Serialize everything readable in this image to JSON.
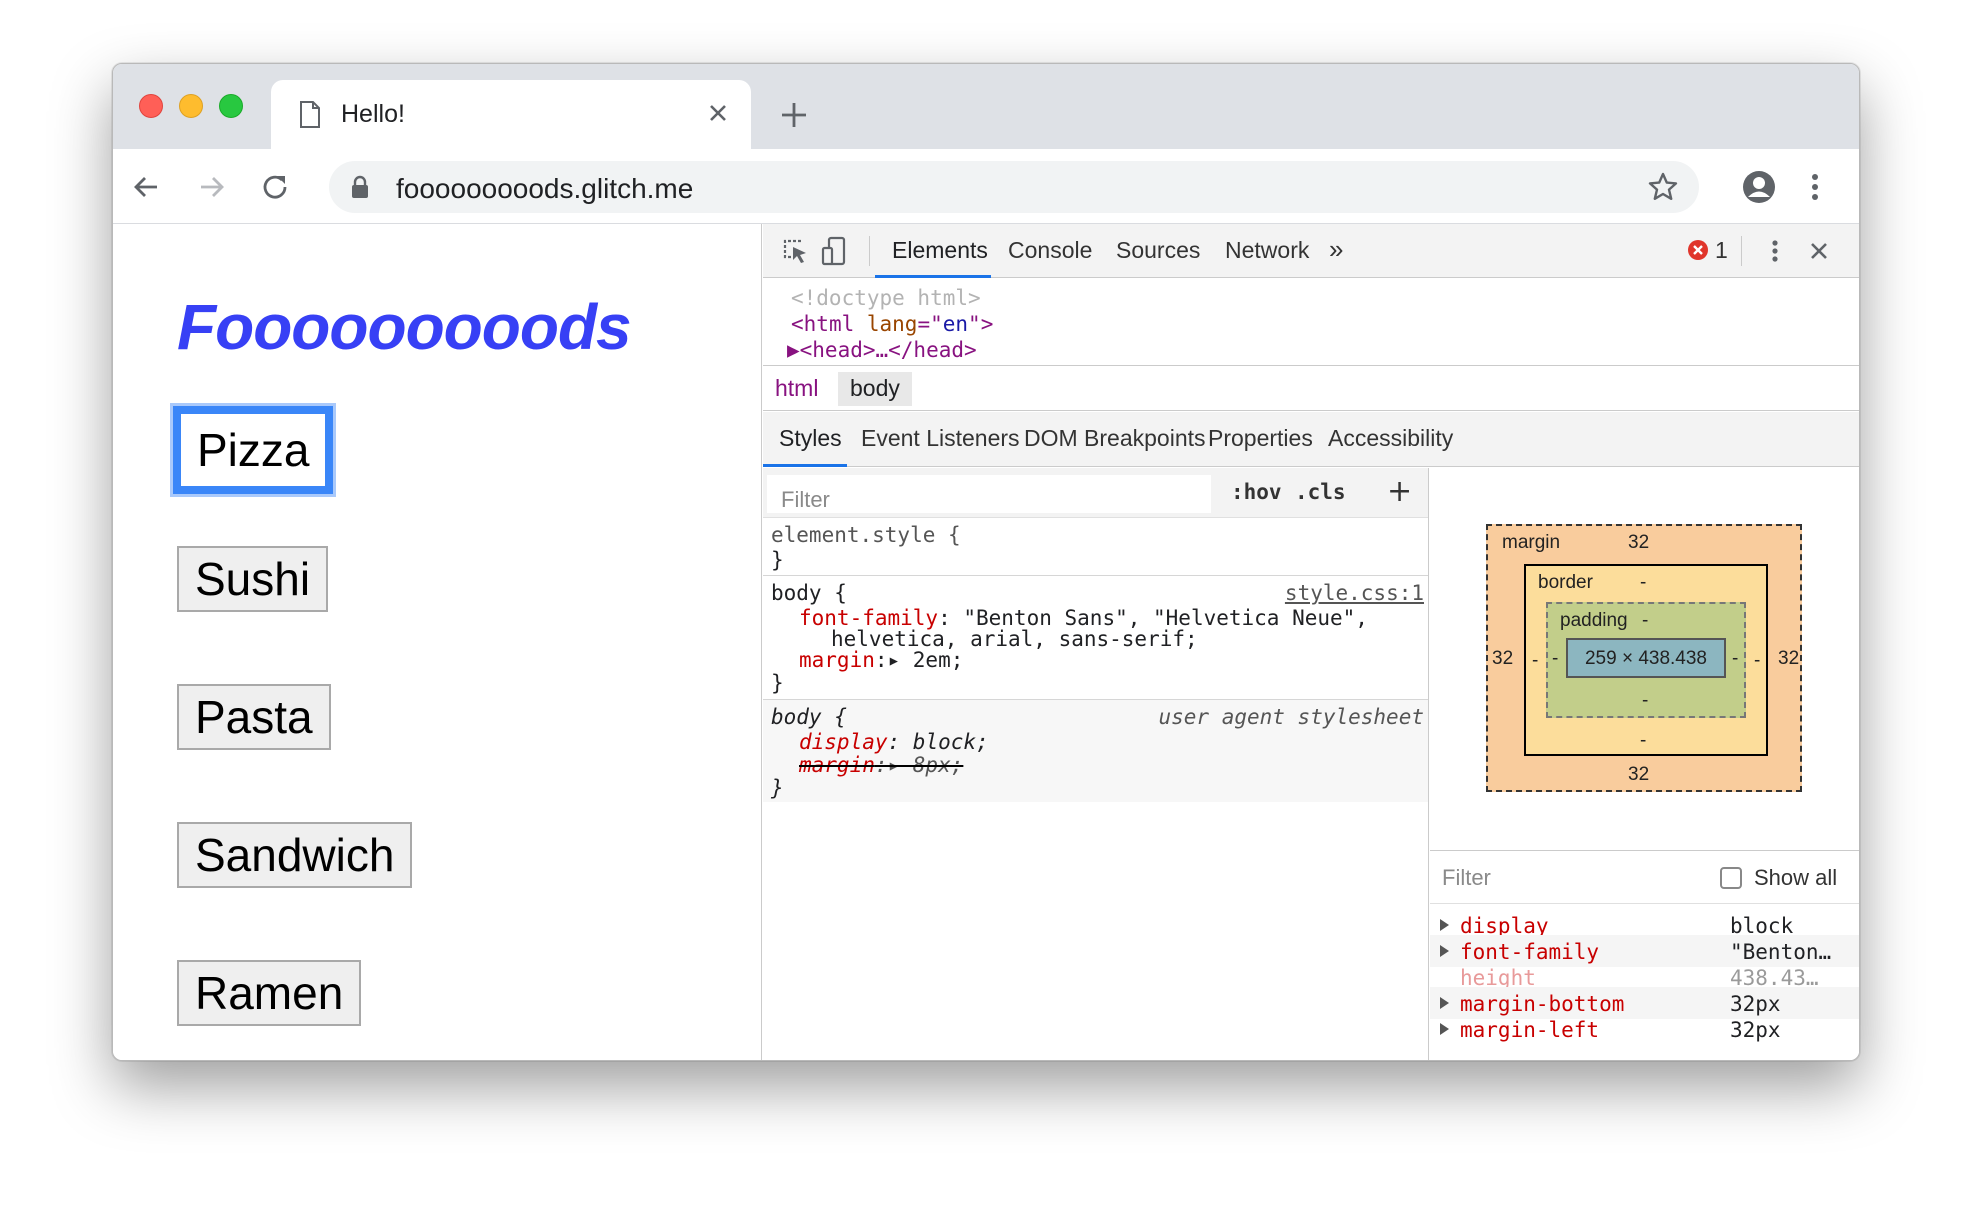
{
  "browser": {
    "tab_title": "Hello!",
    "url": "fooooooooods.glitch.me"
  },
  "page": {
    "heading": "Fooooooooods",
    "buttons": [
      "Pizza",
      "Sushi",
      "Pasta",
      "Sandwich",
      "Ramen"
    ],
    "focused_button": "Pizza"
  },
  "devtools": {
    "tabs": [
      "Elements",
      "Console",
      "Sources",
      "Network",
      "»"
    ],
    "active_tab": "Elements",
    "error_count": "1",
    "dom": {
      "line1": "<!doctype html>",
      "line2_open": "<",
      "line2_tag": "html",
      "line2_attr": " lang",
      "line2_eq": "=\"",
      "line2_val": "en",
      "line2_close": "\">",
      "line3": "▶<head>…</head>"
    },
    "breadcrumbs": [
      "html",
      "body"
    ],
    "subtabs": [
      "Styles",
      "Event Listeners",
      "DOM Breakpoints",
      "Properties",
      "Accessibility"
    ],
    "styles": {
      "filter_placeholder": "Filter",
      "hov": ":hov",
      "cls": ".cls",
      "plus": "+",
      "element_style_open": "element.style {",
      "close_brace": "}",
      "body_rule_selector": "body {",
      "body_rule_source": "style.css:1",
      "font_family_prop": "font-family",
      "font_family_val_1": ": \"Benton Sans\", \"Helvetica Neue\",",
      "font_family_val_2": "helvetica, arial, sans-serif;",
      "margin_prop": "margin",
      "margin_val": ":▸ 2em;",
      "ua_selector": "body {",
      "ua_source": "user agent stylesheet",
      "display_prop": "display",
      "display_val": ": block;",
      "ua_margin_prop": "margin",
      "ua_margin_val": ":▸ 8px;"
    },
    "box_model": {
      "margin_label": "margin",
      "margin_top": "32",
      "margin_bottom": "32",
      "margin_left": "32",
      "margin_right": "32",
      "border_label": "border",
      "border_top": "-",
      "border_bottom": "-",
      "border_left": "-",
      "border_right": "-",
      "padding_label": "padding",
      "padding_top": "-",
      "padding_bottom": "-",
      "padding_left": "-",
      "padding_right": "-",
      "content": "259 × 438.438"
    },
    "computed": {
      "filter_placeholder": "Filter",
      "show_all": "Show all",
      "rows": [
        {
          "name": "display",
          "value": "block"
        },
        {
          "name": "font-family",
          "value": "\"Benton…"
        },
        {
          "name": "height",
          "value": "438.43…"
        },
        {
          "name": "margin-bottom",
          "value": "32px"
        },
        {
          "name": "margin-left",
          "value": "32px"
        }
      ]
    }
  },
  "colors": {
    "heading": "#3740f5",
    "focus_ring": "#3a86f8",
    "devtools_accent": "#1a73e8"
  }
}
